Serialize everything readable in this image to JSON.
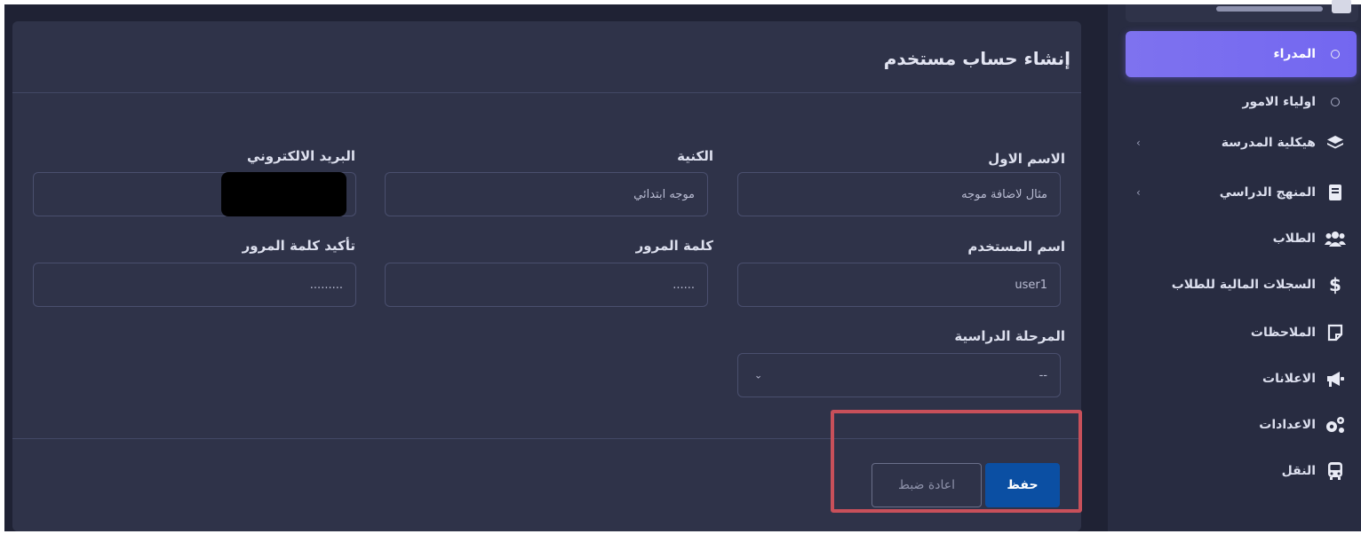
{
  "sidebar": {
    "items": [
      {
        "label": "المدراء",
        "icon": "circle-icon",
        "active": true
      },
      {
        "label": "اولياء الامور",
        "icon": "circle-icon"
      },
      {
        "label": "هيكلية المدرسة",
        "icon": "layers-icon",
        "chevron": "‹"
      },
      {
        "label": "المنهج الدراسي",
        "icon": "book-icon",
        "chevron": "‹"
      },
      {
        "label": "الطلاب",
        "icon": "users-icon"
      },
      {
        "label": "السجلات المالية للطلاب",
        "icon": "dollar-icon"
      },
      {
        "label": "الملاحظات",
        "icon": "note-icon"
      },
      {
        "label": "الاعلانات",
        "icon": "megaphone-icon"
      },
      {
        "label": "الاعدادات",
        "icon": "gears-icon"
      },
      {
        "label": "النقل",
        "icon": "bus-icon"
      }
    ]
  },
  "form": {
    "title": "إنشاء حساب مستخدم",
    "first_name": {
      "label": "الاسم الاول",
      "placeholder": "مثال لاضافة موجه"
    },
    "nickname": {
      "label": "الكنية",
      "placeholder": "موجه ابتدائي"
    },
    "email": {
      "label": "البريد الالكتروني",
      "value": ""
    },
    "username": {
      "label": "اسم المستخدم",
      "value": "user1"
    },
    "password": {
      "label": "كلمة المرور",
      "value": "......"
    },
    "confirm_password": {
      "label": "تأكيد كلمة المرور",
      "value": "........."
    },
    "stage": {
      "label": "المرحلة الدراسية",
      "value": "--"
    },
    "save_label": "حفظ",
    "reset_label": "اعادة ضبط"
  },
  "colors": {
    "accent": "#7367f0",
    "save_button": "#0b4fa3",
    "highlight": "#c8505a",
    "card_bg": "#2f3349",
    "page_bg": "#1f2234"
  }
}
